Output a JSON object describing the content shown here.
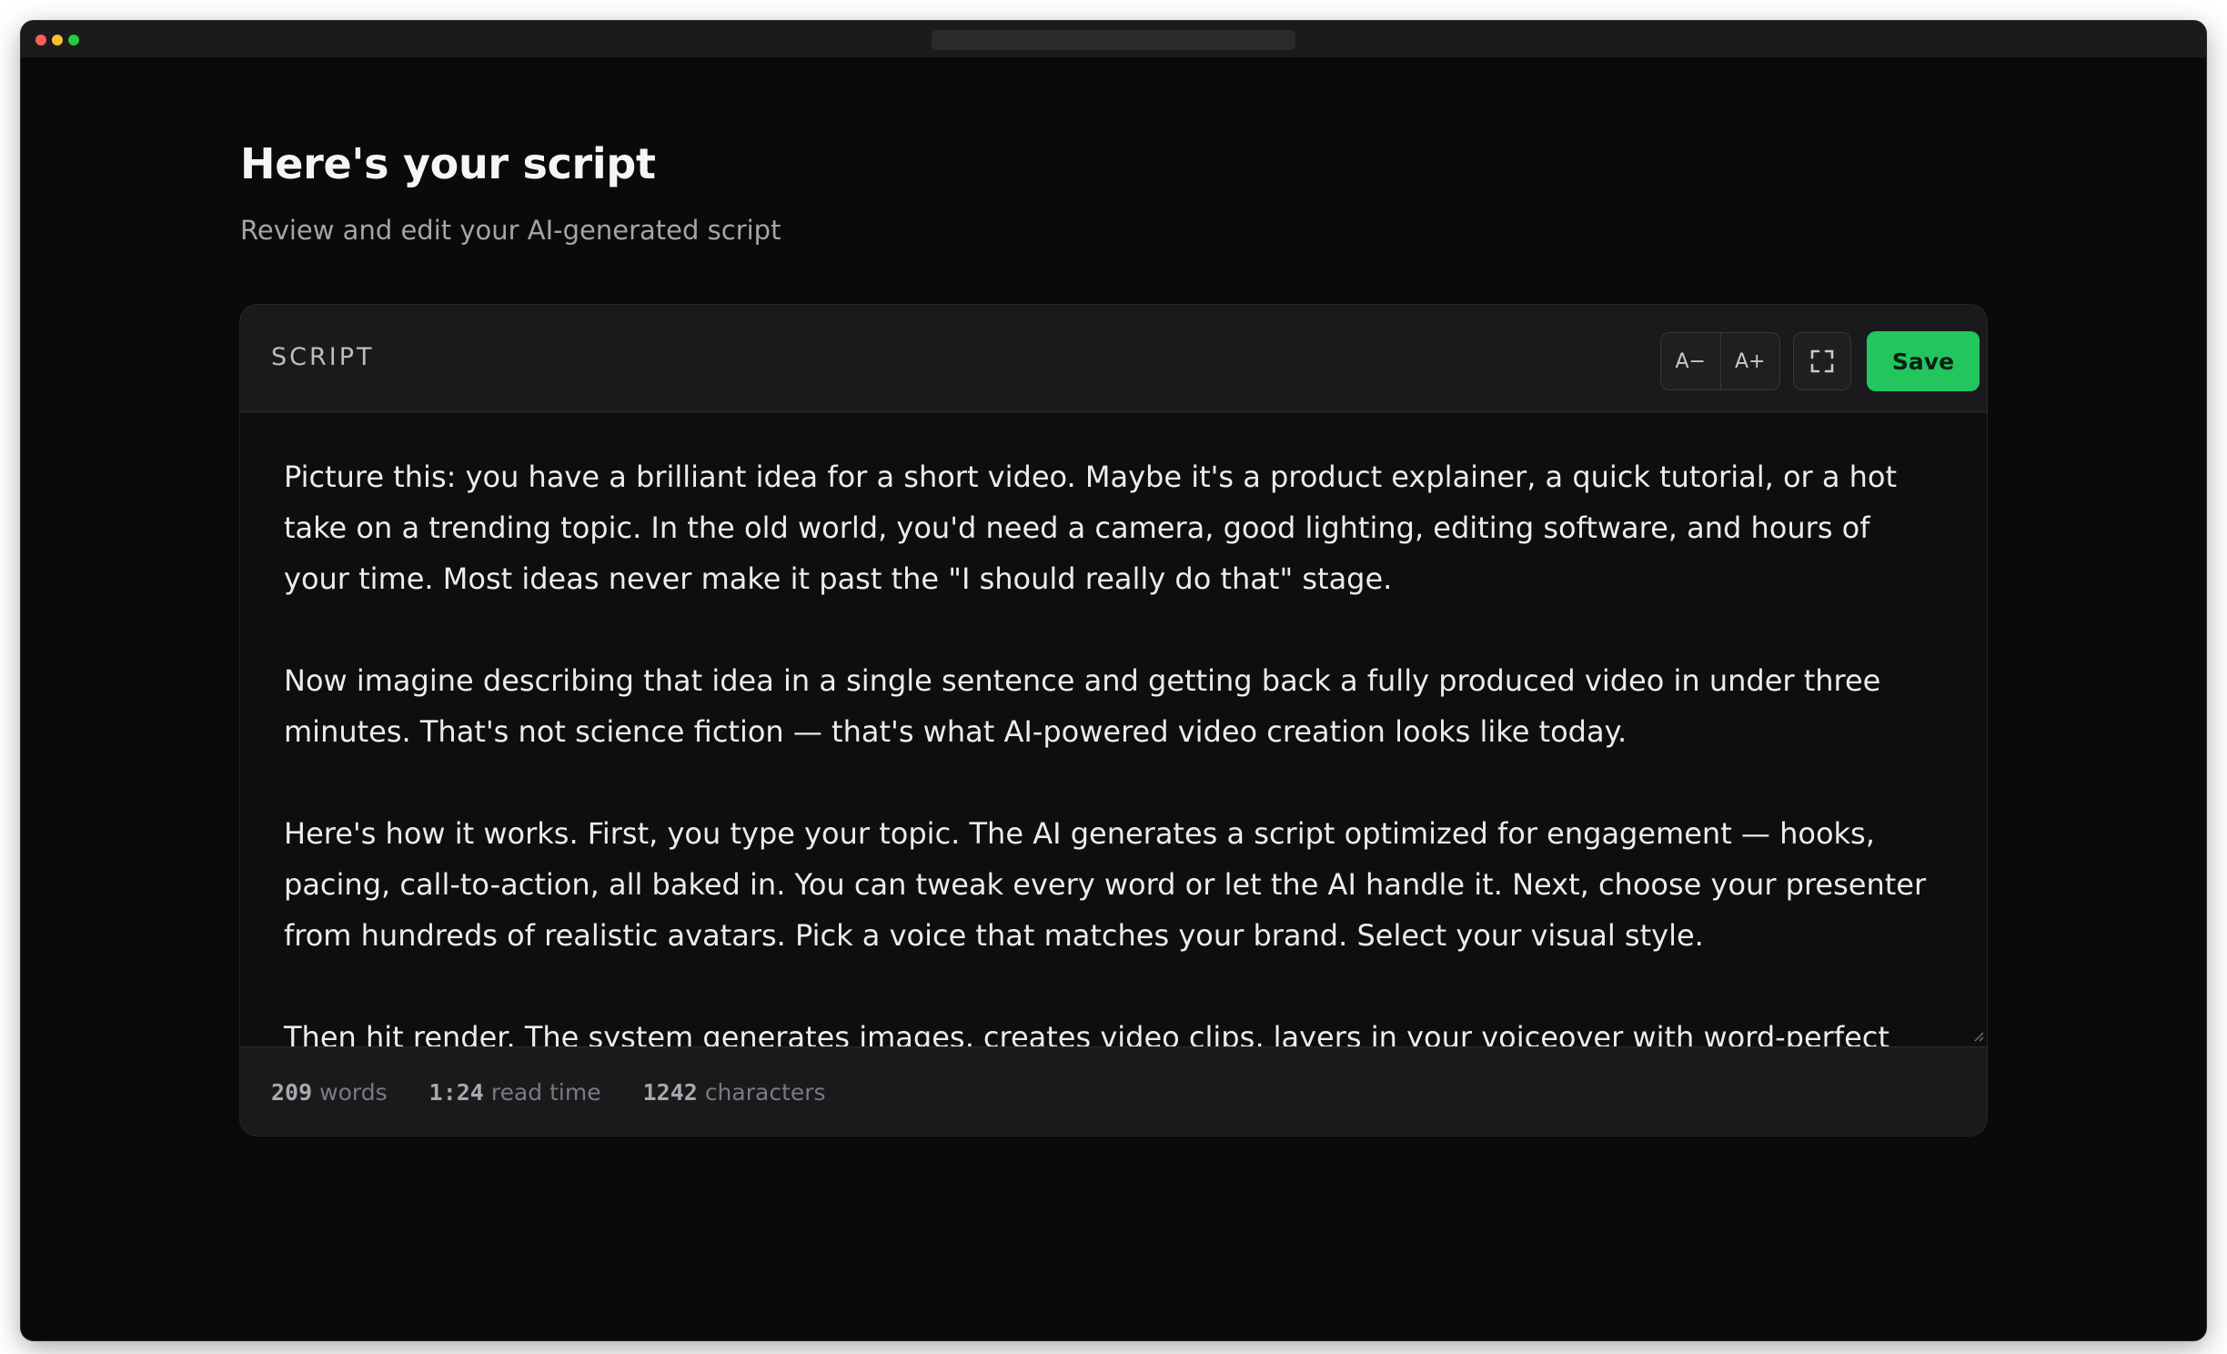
{
  "page": {
    "title": "Here's your script",
    "subtitle": "Review and edit your AI-generated script"
  },
  "card": {
    "label": "SCRIPT",
    "toolbar": {
      "decrease_font_label": "A−",
      "increase_font_label": "A+",
      "fullscreen_icon": "expand-corners-icon",
      "save_label": "Save"
    },
    "script_paragraphs": [
      "Picture this: you have a brilliant idea for a short video. Maybe it's a product explainer, a quick tutorial, or a hot take on a trending topic. In the old world, you'd need a camera, good lighting, editing software, and hours of your time. Most ideas never make it past the \"I should really do that\" stage.",
      "Now imagine describing that idea in a single sentence and getting back a fully produced video in under three minutes. That's not science fiction — that's what AI-powered video creation looks like today.",
      "Here's how it works. First, you type your topic. The AI generates a script optimized for engagement — hooks, pacing, call-to-action, all baked in. You can tweak every word or let the AI handle it. Next, choose your presenter from hundreds of realistic avatars. Pick a voice that matches your brand. Select your visual style.",
      "Then hit render. The system generates images, creates video clips, layers in your voiceover with word-perfect captions,"
    ],
    "stats": {
      "words_value": "209",
      "words_label": "words",
      "read_time_value": "1:24",
      "read_time_label": "read time",
      "characters_value": "1242",
      "characters_label": "characters"
    }
  },
  "colors": {
    "accent": "#22c55e",
    "background": "#0a0a0b",
    "card": "#1a1a1c"
  }
}
